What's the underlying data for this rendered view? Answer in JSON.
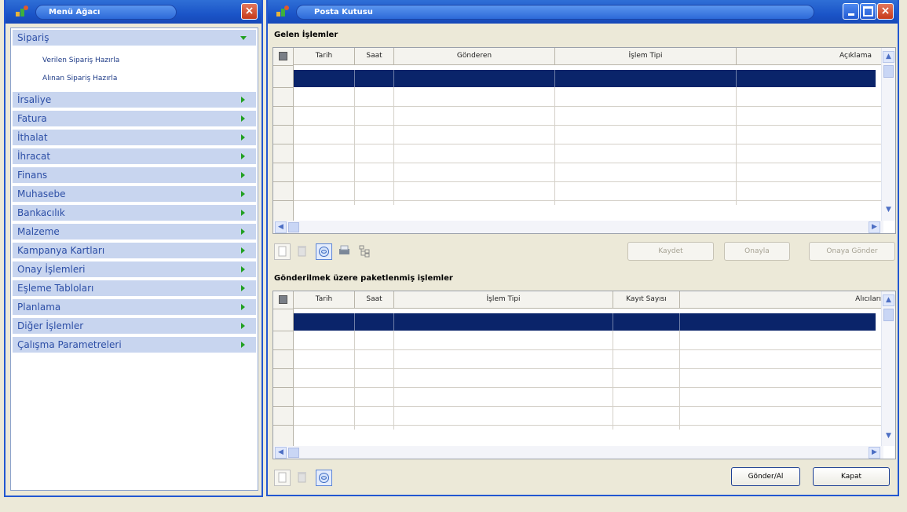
{
  "left_window": {
    "title": "Menü Ağacı",
    "menu": [
      {
        "label": "Sipariş",
        "expanded": true,
        "children": [
          "Verilen Sipariş Hazırla",
          "Alınan Sipariş Hazırla"
        ]
      },
      {
        "label": "İrsaliye"
      },
      {
        "label": "Fatura"
      },
      {
        "label": "İthalat"
      },
      {
        "label": "İhracat"
      },
      {
        "label": "Finans"
      },
      {
        "label": "Muhasebe"
      },
      {
        "label": "Bankacılık"
      },
      {
        "label": "Malzeme"
      },
      {
        "label": "Kampanya Kartları"
      },
      {
        "label": "Onay İşlemleri"
      },
      {
        "label": "Eşleme Tabloları"
      },
      {
        "label": "Planlama"
      },
      {
        "label": "Diğer İşlemler"
      },
      {
        "label": "Çalışma Parametreleri"
      }
    ]
  },
  "right_window": {
    "title": "Posta Kutusu",
    "incoming": {
      "section_title": "Gelen İşlemler",
      "columns": [
        "Tarih",
        "Saat",
        "Gönderen",
        "İşlem Tipi",
        "Açıklama"
      ],
      "buttons": {
        "save": "Kaydet",
        "approve": "Onayla",
        "send_for_approval": "Onaya Gönder"
      }
    },
    "outgoing": {
      "section_title": "Gönderilmek üzere paketlenmiş işlemler",
      "columns": [
        "Tarih",
        "Saat",
        "İşlem Tipi",
        "Kayıt Sayısı",
        "Alıcıları"
      ]
    },
    "buttons": {
      "send_receive": "Gönder/Al",
      "close": "Kapat"
    }
  },
  "colors": {
    "titlebar": "#1b55c8",
    "menu_row": "#c8d5ef",
    "selected_row": "#0a246a"
  }
}
